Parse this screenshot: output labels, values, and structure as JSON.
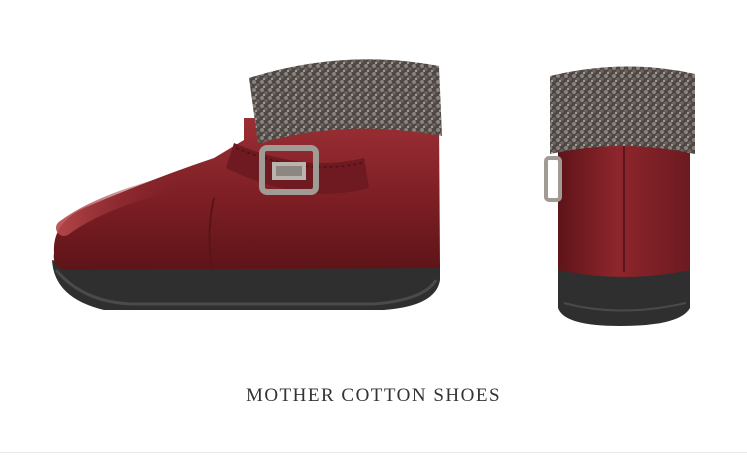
{
  "product": {
    "title": "MOTHER COTTON SHOES",
    "tagline": "",
    "colors": {
      "leather": "#7c1e24",
      "leather_highlight": "#a8383c",
      "fur": "#5a5350",
      "sole": "#3a3a3a",
      "buckle": "#9a9590"
    }
  }
}
